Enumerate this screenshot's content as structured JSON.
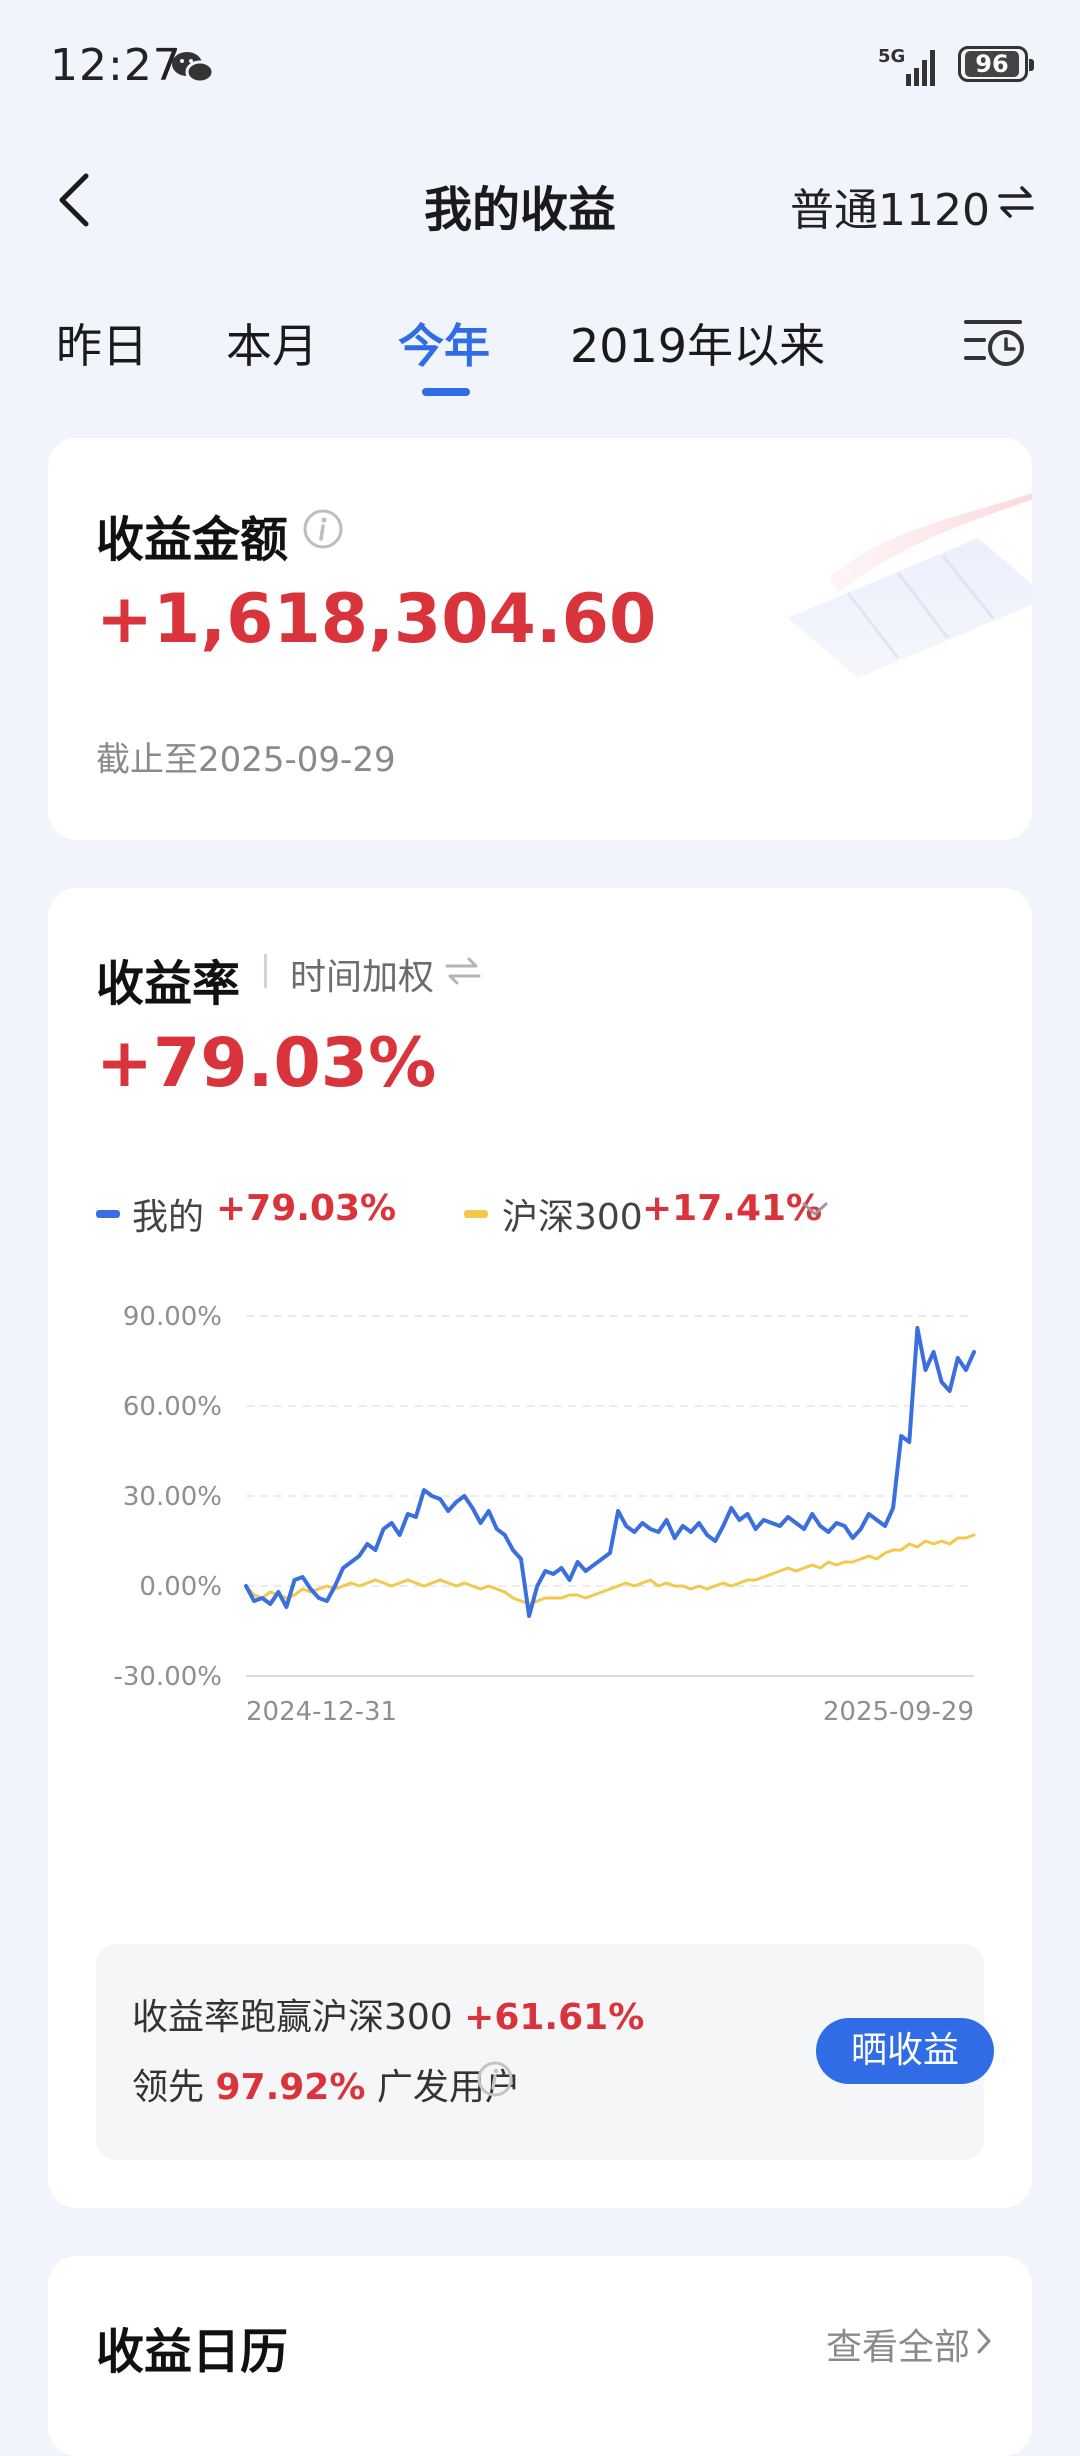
{
  "status_bar": {
    "time": "12:27",
    "battery": "96",
    "network": "5G"
  },
  "header": {
    "title": "我的收益",
    "account": "普通1120"
  },
  "tabs": [
    {
      "label": "昨日",
      "active": false
    },
    {
      "label": "本月",
      "active": false
    },
    {
      "label": "今年",
      "active": true
    },
    {
      "label": "2019年以来",
      "active": false
    }
  ],
  "earnings_card": {
    "title": "收益金额",
    "amount": "+1,618,304.60",
    "as_of": "截止至2025-09-29"
  },
  "return_card": {
    "title": "收益率",
    "weighting": "时间加权",
    "rate": "+79.03%",
    "legend": [
      {
        "name": "我的",
        "value": "+79.03%",
        "color": "#3b6fe0"
      },
      {
        "name": "沪深300",
        "value": "+17.41%",
        "color": "#f2c94c"
      }
    ],
    "compare_text_prefix": "收益率跑赢沪深300",
    "compare_value": "+61.61%",
    "lead_prefix": "领先",
    "lead_value": "97.92%",
    "lead_suffix": "广发用户",
    "share_button": "晒收益"
  },
  "calendar_card": {
    "title": "收益日历",
    "view_all": "查看全部"
  },
  "chart_data": {
    "type": "line",
    "y_ticks": [
      "90.00%",
      "60.00%",
      "30.00%",
      "0.00%",
      "-30.00%"
    ],
    "ylim": [
      -30,
      90
    ],
    "x_labels": [
      "2024-12-31",
      "2025-09-29"
    ],
    "grid": true,
    "series": [
      {
        "name": "我的",
        "color": "#3b6fe0",
        "values": [
          0,
          -5,
          -4,
          -6,
          -2,
          -7,
          2,
          3,
          -1,
          -4,
          -5,
          0,
          6,
          8,
          10,
          14,
          12,
          19,
          21,
          17,
          24,
          23,
          32,
          30,
          29,
          25,
          28,
          30,
          26,
          21,
          25,
          19,
          17,
          12,
          9,
          -10,
          0,
          5,
          4,
          6,
          2,
          8,
          5,
          7,
          9,
          11,
          25,
          20,
          18,
          21,
          19,
          18,
          22,
          16,
          20,
          18,
          21,
          17,
          15,
          20,
          26,
          22,
          24,
          19,
          22,
          21,
          20,
          23,
          21,
          19,
          24,
          20,
          18,
          21,
          20,
          16,
          19,
          24,
          22,
          20,
          26,
          50,
          48,
          86,
          72,
          78,
          68,
          65,
          76,
          72,
          78
        ],
        "last_label": "+79.03%"
      },
      {
        "name": "沪深300",
        "color": "#f2c94c",
        "values": [
          0,
          -3,
          -4,
          -2,
          -3,
          -4,
          -3,
          -1,
          -2,
          -1,
          0,
          -1,
          0,
          1,
          0,
          1,
          2,
          1,
          0,
          1,
          2,
          1,
          0,
          1,
          2,
          1,
          0,
          1,
          0,
          -1,
          0,
          -1,
          -2,
          -4,
          -5,
          -6,
          -5,
          -4,
          -4,
          -4,
          -3,
          -3,
          -4,
          -3,
          -2,
          -1,
          0,
          1,
          0,
          1,
          2,
          0,
          1,
          0,
          0,
          -1,
          0,
          -1,
          0,
          1,
          0,
          1,
          2,
          2,
          3,
          4,
          5,
          6,
          5,
          6,
          7,
          6,
          8,
          7,
          8,
          8,
          9,
          10,
          9,
          11,
          12,
          12,
          14,
          13,
          15,
          14,
          15,
          14,
          16,
          16,
          17
        ],
        "last_label": "+17.41%"
      }
    ]
  }
}
